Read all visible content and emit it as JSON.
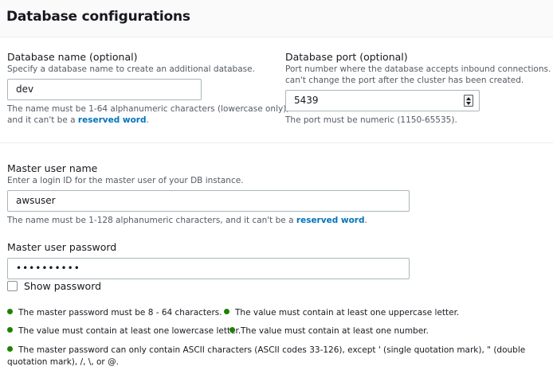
{
  "header": {
    "title": "Database configurations"
  },
  "db_name": {
    "label": "Database name (optional)",
    "description": "Specify a database name to create an additional database.",
    "value": "dev",
    "help_prefix": "The name must be 1-64 alphanumeric characters (lowercase only),",
    "help_line2_prefix": "and it can't be a ",
    "help_link": "reserved word",
    "help_suffix": "."
  },
  "db_port": {
    "label": "Database port (optional)",
    "description_line1": "Port number where the database accepts inbound connections. You",
    "description_line2": "can't change the port after the cluster has been created.",
    "value": "5439",
    "help": "The port must be numeric (1150-65535)."
  },
  "master_user": {
    "label": "Master user name",
    "description": "Enter a login ID for the master user of your DB instance.",
    "value": "awsuser",
    "help_prefix": "The name must be 1-128 alphanumeric characters, and it can't be a ",
    "help_link": "reserved word",
    "help_suffix": "."
  },
  "master_password": {
    "label": "Master user password",
    "value": "••••••••••",
    "show_password_label": "Show password",
    "show_password_checked": false
  },
  "requirements": [
    "The master password must be 8 - 64 characters.",
    "The value must contain at least one uppercase letter.",
    "The value must contain at least one lowercase letter.",
    "The value must contain at least one number.",
    "The master password can only contain ASCII characters (ASCII codes 33-126), except ' (single quotation mark), \" (double quotation mark), /, \\, or @."
  ],
  "colors": {
    "valid": "#1d8102",
    "link": "#0073bb",
    "border": "#aab7b8"
  }
}
